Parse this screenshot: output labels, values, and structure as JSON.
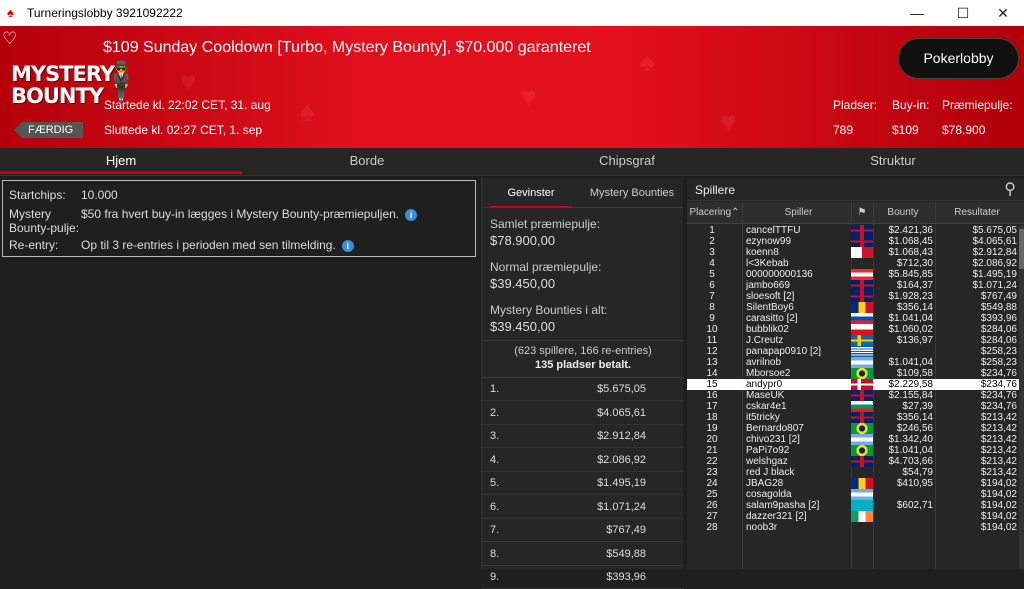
{
  "window": {
    "title": "Turneringslobby 3921092222",
    "minimize": "—",
    "maximize": "☐",
    "close": "✕"
  },
  "banner": {
    "tournament_name": "$109 Sunday Cooldown [Turbo, Mystery Bounty], $70.000 garanteret",
    "logo_line1": "MYSTERY",
    "logo_line2": "BOUNTY",
    "status_badge": "FÆRDIG",
    "started": "Startede kl. 22:02 CET, 31. aug",
    "ended": "Sluttede kl. 02:27 CET, 1. sep",
    "lobby_button": "Pokerlobby",
    "stats": {
      "seats_label": "Pladser:",
      "seats": "789",
      "buyin_label": "Buy-in:",
      "buyin": "$109",
      "prizepool_label": "Præmiepulje:",
      "prizepool": "$78.900"
    }
  },
  "tabs": [
    "Hjem",
    "Borde",
    "Chipsgraf",
    "Struktur"
  ],
  "info": {
    "startchips_label": "Startchips:",
    "startchips": "10.000",
    "bounty_label": "Mystery Bounty-pulje:",
    "bounty_label_line1": "Mystery",
    "bounty_label_line2": "Bounty-pulje:",
    "bounty_value": "$50 fra hvert buy-in lægges i Mystery Bounty-præmiepuljen.",
    "reentry_label": "Re-entry:",
    "reentry_value": "Op til 3 re-entries i perioden med sen tilmelding."
  },
  "prizes": {
    "tab_winnings": "Gevinster",
    "tab_bounties": "Mystery Bounties",
    "total_label": "Samlet præmiepulje:",
    "total": "$78.900,00",
    "normal_label": "Normal præmiepulje:",
    "normal": "$39.450,00",
    "bounties_label": "Mystery Bounties i alt:",
    "bounties": "$39.450,00",
    "players_info": "(623 spillere, 166 re-entries)",
    "paid_info": "135 pladser betalt.",
    "rows": [
      [
        "1.",
        "$5.675,05"
      ],
      [
        "2.",
        "$4.065,61"
      ],
      [
        "3.",
        "$2.912,84"
      ],
      [
        "4.",
        "$2.086,92"
      ],
      [
        "5.",
        "$1.495,19"
      ],
      [
        "6.",
        "$1.071,24"
      ],
      [
        "7.",
        "$767,49"
      ],
      [
        "8.",
        "$549,88"
      ],
      [
        "9.",
        "$393,96"
      ]
    ]
  },
  "players": {
    "header": "Spillere",
    "columns": {
      "place": "Placering",
      "player": "Spiller",
      "flag": "⚑",
      "bounty": "Bounty",
      "results": "Resultater"
    },
    "highlight_row": 15,
    "rows": [
      [
        "1",
        "cancelTTFU",
        "uk",
        "$2.421,36",
        "$5.675,05"
      ],
      [
        "2",
        "ezynow99",
        "uk",
        "$1.068,45",
        "$4.065,61"
      ],
      [
        "3",
        "koenn8",
        "mt",
        "$1.068,43",
        "$2.912,84"
      ],
      [
        "4",
        "l<3Kebab",
        "",
        "$712,30",
        "$2.086,92"
      ],
      [
        "5",
        "000000000136",
        "at",
        "$5.845,85",
        "$1.495,19"
      ],
      [
        "6",
        "jambo669",
        "uk",
        "$164,37",
        "$1.071,24"
      ],
      [
        "7",
        "sloesoft [2]",
        "uk",
        "$1.928,23",
        "$767,49"
      ],
      [
        "8",
        "SilentBoy6",
        "ro",
        "$356,14",
        "$549,88"
      ],
      [
        "9",
        "carasitto [2]",
        "sk",
        "$1.041,04",
        "$393,96"
      ],
      [
        "10",
        "bubblik02",
        "cz",
        "$1.060,02",
        "$284,06"
      ],
      [
        "11",
        "J.Creutz",
        "se",
        "$136,97",
        "$284,06"
      ],
      [
        "12",
        "panapap0910 [2]",
        "gr",
        "",
        "$258,23"
      ],
      [
        "13",
        "avrilnob",
        "ar",
        "$1.041,04",
        "$258,23"
      ],
      [
        "14",
        "Mborsoe2",
        "br",
        "$109,58",
        "$234,76"
      ],
      [
        "15",
        "andypr0",
        "dk",
        "$2.229,58",
        "$234,76"
      ],
      [
        "16",
        "MaseUK",
        "uk",
        "$2.155,84",
        "$234,76"
      ],
      [
        "17",
        "cskar4e1",
        "bg",
        "$27,39",
        "$234,76"
      ],
      [
        "18",
        "it5tricky",
        "uk",
        "$356,14",
        "$213,42"
      ],
      [
        "19",
        "Bernardo807",
        "br",
        "$246,56",
        "$213,42"
      ],
      [
        "20",
        "chivo231 [2]",
        "ar",
        "$1.342,40",
        "$213,42"
      ],
      [
        "21",
        "PaPi7o92",
        "br",
        "$1.041,04",
        "$213,42"
      ],
      [
        "22",
        "welshgaz",
        "uk",
        "$4.703,66",
        "$213,42"
      ],
      [
        "23",
        "red J black",
        "",
        "$54,79",
        "$213,42"
      ],
      [
        "24",
        "JBAG28",
        "ro",
        "$410,95",
        "$194,02"
      ],
      [
        "25",
        "cosagolda",
        "ar",
        "",
        "$194,02"
      ],
      [
        "26",
        "salam9pasha [2]",
        "kz",
        "$602,71",
        "$194,02"
      ],
      [
        "27",
        "dazzer321 [2]",
        "ie",
        "",
        "$194,02"
      ],
      [
        "28",
        "noob3r",
        "",
        "",
        "$194,02"
      ]
    ]
  },
  "colors": {
    "accent": "#c80014",
    "banner": "#e0101d",
    "highlight": "#ffffff"
  }
}
